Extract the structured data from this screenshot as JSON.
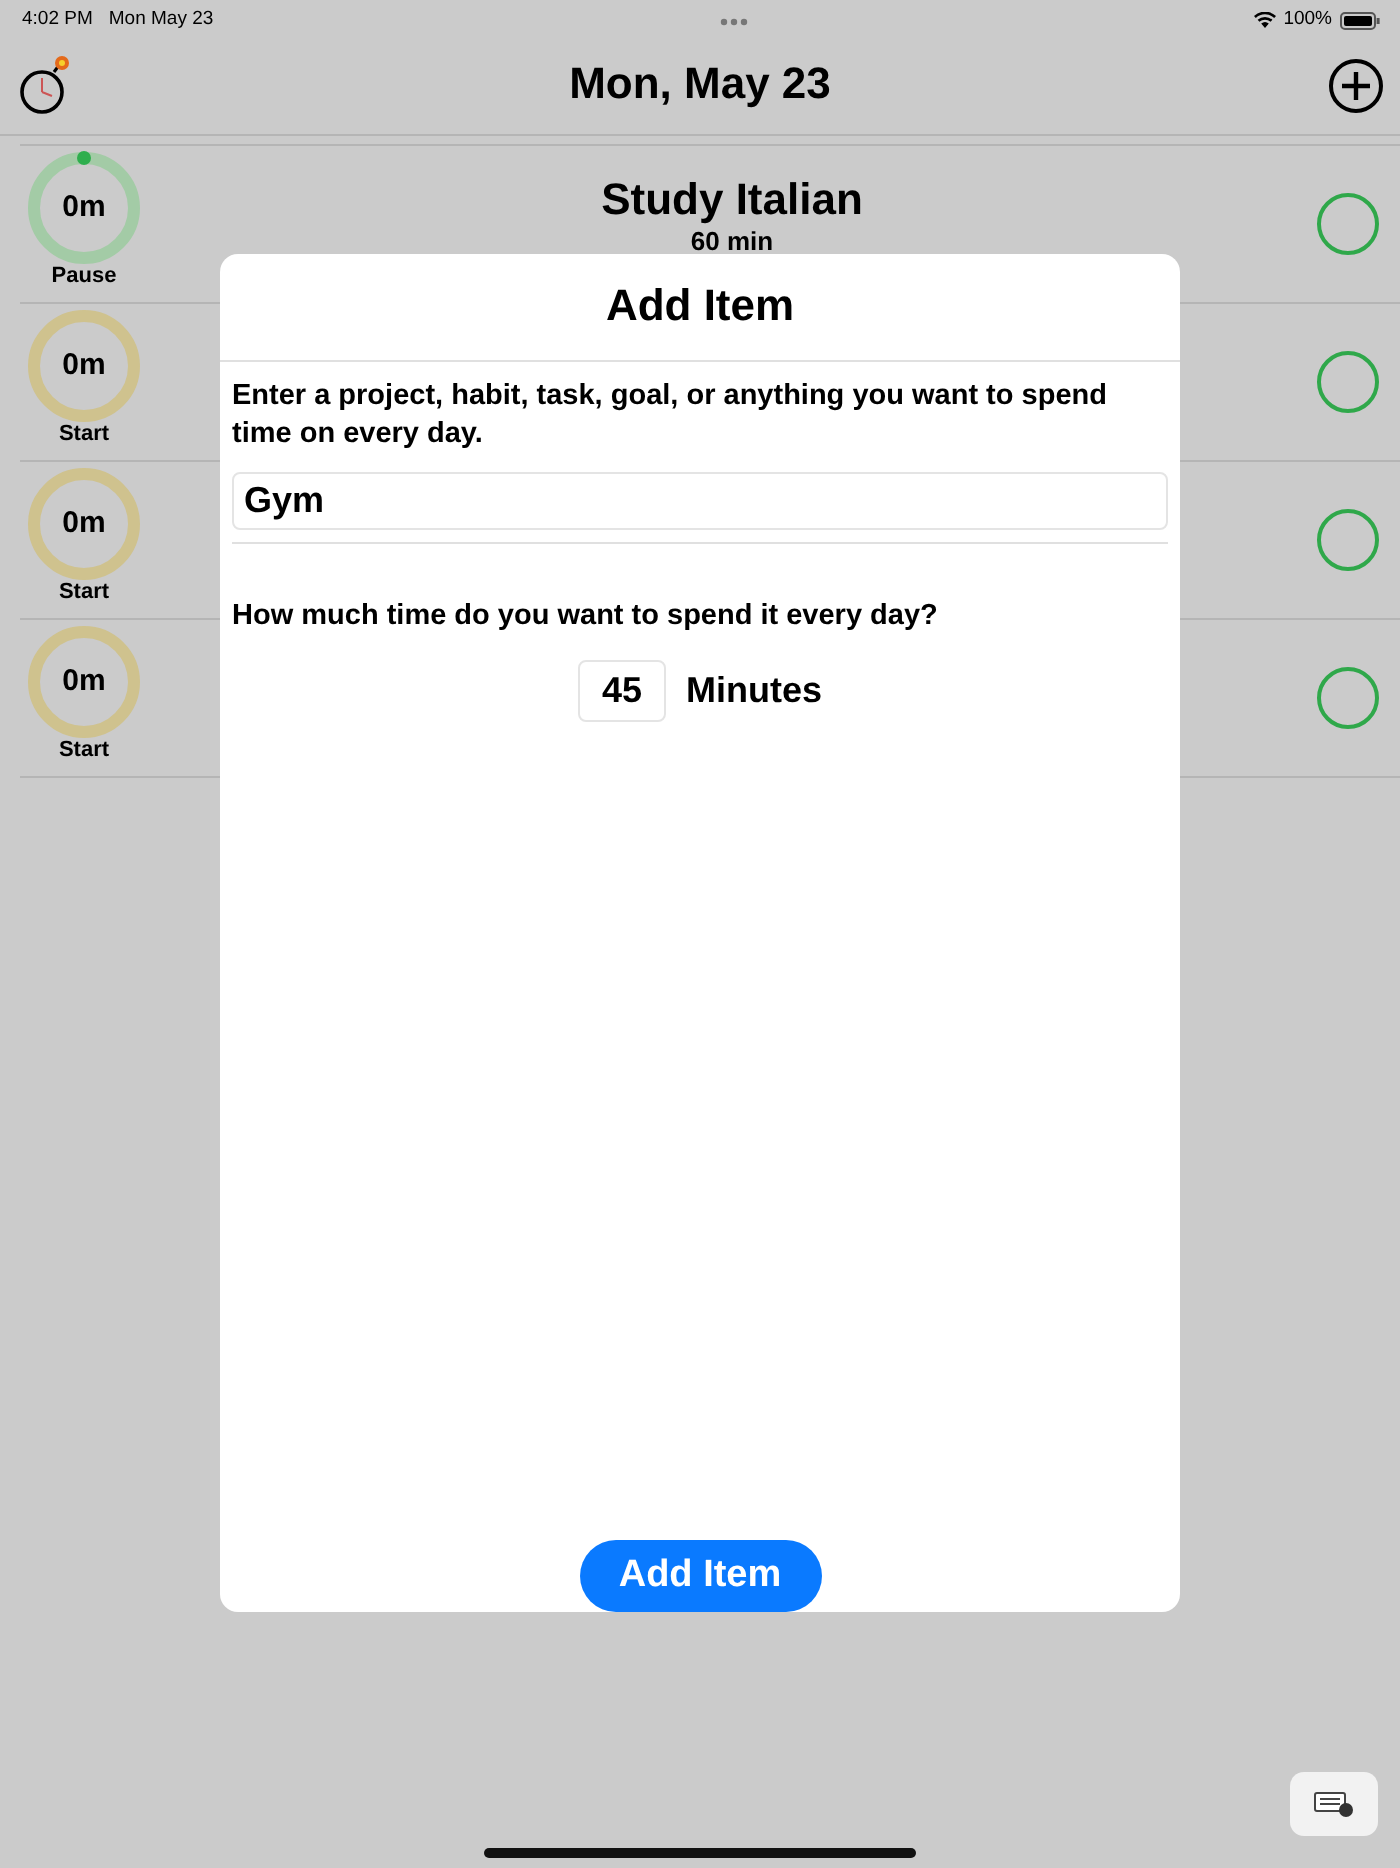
{
  "status_bar": {
    "time": "4:02 PM",
    "date": "Mon May 23",
    "battery": "100%"
  },
  "header": {
    "title": "Mon, May 23"
  },
  "items": [
    {
      "elapsed": "0m",
      "running": true,
      "action": "Pause",
      "title": "Study Italian",
      "subtitle": "60 min"
    },
    {
      "elapsed": "0m",
      "running": false,
      "action": "Start"
    },
    {
      "elapsed": "0m",
      "running": false,
      "action": "Start"
    },
    {
      "elapsed": "0m",
      "running": false,
      "action": "Start"
    }
  ],
  "dialog": {
    "title": "Add Item",
    "prompt": "Enter a project, habit, task, goal, or anything you want to spend time on every day.",
    "name_field": {
      "value": "Gym"
    },
    "time_question": "How much time do you want to spend it every day?",
    "minutes_field": {
      "value": "45"
    },
    "unit_label": "Minutes",
    "submit_button": "Add Item"
  }
}
